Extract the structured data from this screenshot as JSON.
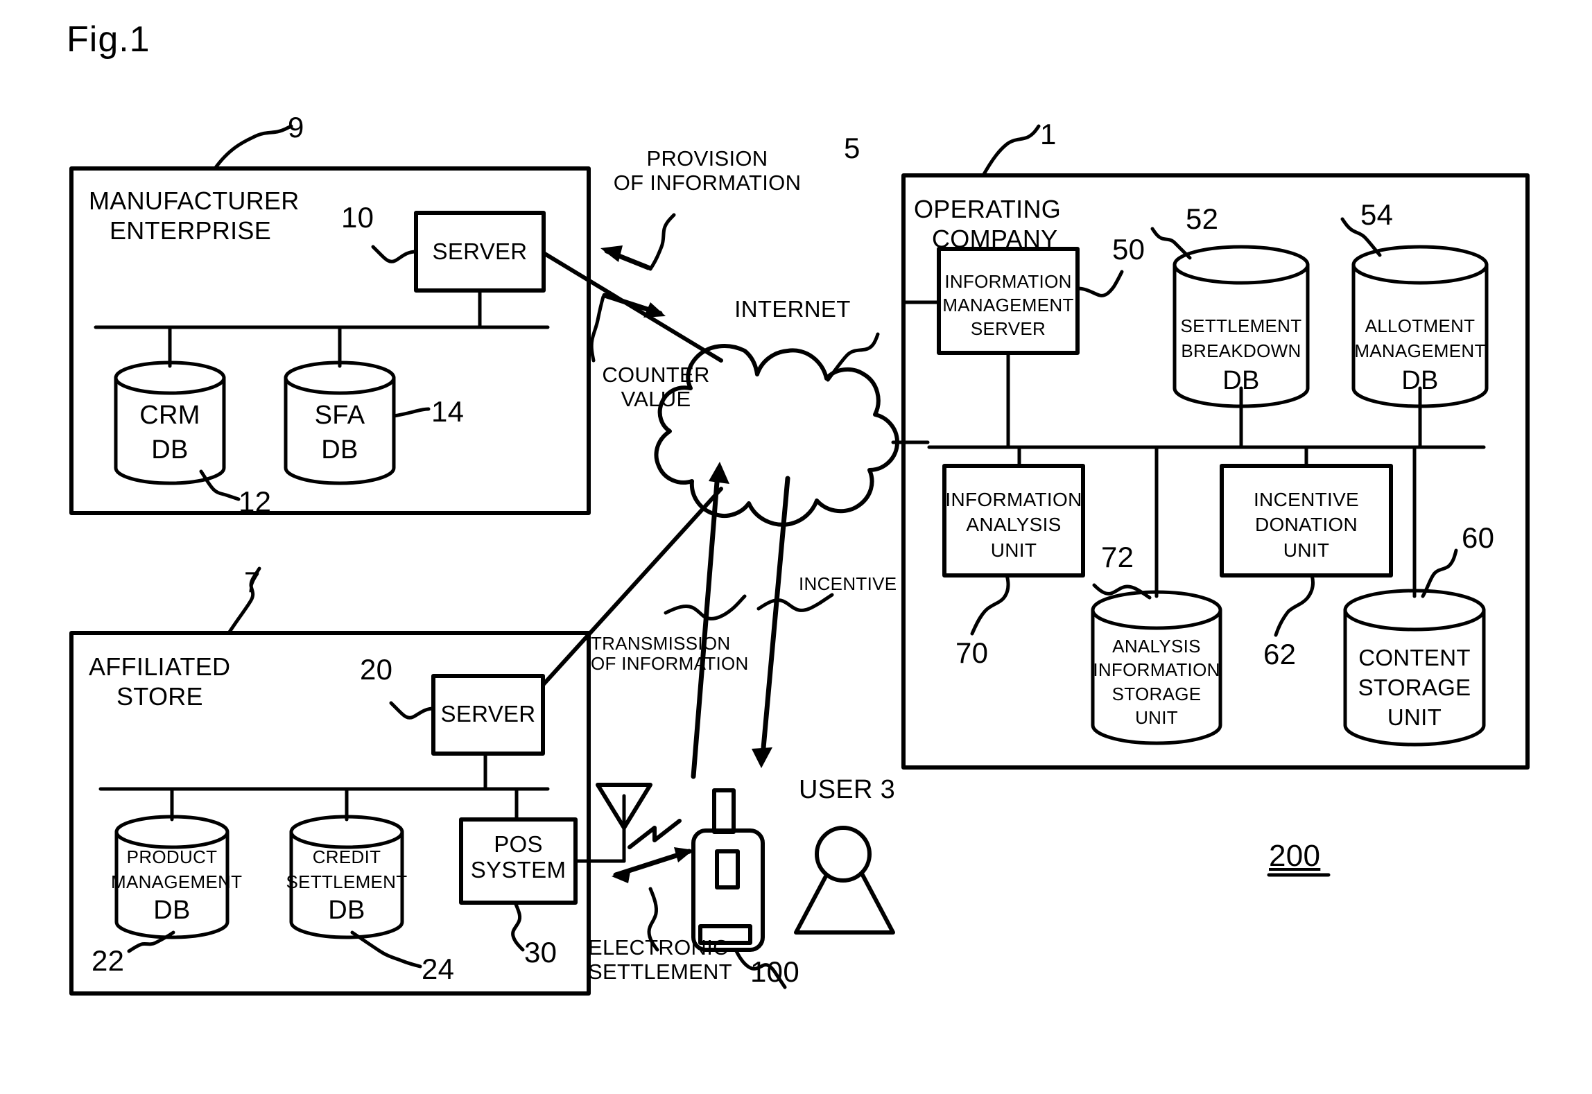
{
  "figure": {
    "title": "Fig.1",
    "system_ref": "200"
  },
  "manufacturer": {
    "ref": "9",
    "title_line1": "MANUFACTURER",
    "title_line2": "ENTERPRISE",
    "server": {
      "ref": "10",
      "label": "SERVER"
    },
    "databases": [
      {
        "ref": "12",
        "line1": "CRM",
        "line2": "DB"
      },
      {
        "ref": "14",
        "line1": "SFA",
        "line2": "DB"
      }
    ]
  },
  "affiliated_store": {
    "ref": "7",
    "title_line1": "AFFILIATED",
    "title_line2": "STORE",
    "server": {
      "ref": "20",
      "label": "SERVER"
    },
    "databases": [
      {
        "ref": "22",
        "line1": "PRODUCT",
        "line2": "MANAGEMENT",
        "line3": "DB"
      },
      {
        "ref": "24",
        "line1": "CREDIT",
        "line2": "SETTLEMENT",
        "line3": "DB"
      }
    ],
    "pos": {
      "ref": "30",
      "line1": "POS",
      "line2": "SYSTEM"
    }
  },
  "internet": {
    "ref": "5",
    "label": "INTERNET"
  },
  "operating_company": {
    "ref": "1",
    "title_line1": "OPERATING",
    "title_line2": "COMPANY",
    "info_management_server": {
      "ref": "50",
      "line1": "INFORMATION",
      "line2": "MANAGEMENT",
      "line3": "SERVER"
    },
    "databases": [
      {
        "ref": "52",
        "line1": "SETTLEMENT",
        "line2": "BREAKDOWN",
        "line3": "DB"
      },
      {
        "ref": "54",
        "line1": "ALLOTMENT",
        "line2": "MANAGEMENT",
        "line3": "DB"
      }
    ],
    "units": [
      {
        "ref": "70",
        "line1": "INFORMATION",
        "line2": "ANALYSIS",
        "line3": "UNIT"
      },
      {
        "ref": "62",
        "line1": "INCENTIVE",
        "line2": "DONATION",
        "line3": "UNIT"
      }
    ],
    "storage": [
      {
        "ref": "72",
        "line1": "ANALYSIS",
        "line2": "INFORMATION",
        "line3": "STORAGE",
        "line4": "UNIT"
      },
      {
        "ref": "60",
        "line1": "CONTENT",
        "line2": "STORAGE",
        "line3": "UNIT"
      }
    ]
  },
  "user_terminal": {
    "ref": "100",
    "user_label": "USER 3"
  },
  "flows": {
    "provision_of_information_line1": "PROVISION",
    "provision_of_information_line2": "OF INFORMATION",
    "counter_value_line1": "COUNTER",
    "counter_value_line2": "VALUE",
    "transmission_line1": "TRANSMISSION",
    "transmission_line2": "OF INFORMATION",
    "incentive": "INCENTIVE",
    "electronic_settlement_line1": "ELECTRONIC",
    "electronic_settlement_line2": "SETTLEMENT"
  },
  "colors": {
    "ink": "#000000",
    "paper": "#ffffff"
  }
}
